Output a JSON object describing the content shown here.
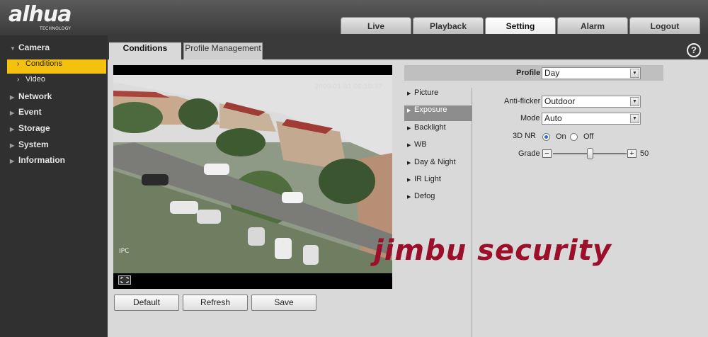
{
  "brand": {
    "name": "alhua",
    "tagline": "TECHNOLOGY"
  },
  "nav_tabs": [
    "Live",
    "Playback",
    "Setting",
    "Alarm",
    "Logout"
  ],
  "nav_active": "Setting",
  "sidebar": {
    "camera": "Camera",
    "sub_items": [
      "Conditions",
      "Video"
    ],
    "sub_active": "Conditions",
    "sections": [
      "Network",
      "Event",
      "Storage",
      "System",
      "Information"
    ]
  },
  "content_tabs": [
    "Conditions",
    "Profile Management"
  ],
  "content_tab_active": "Conditions",
  "help_label": "?",
  "video": {
    "timestamp": "2000-01-01 00:10:37",
    "channel": "IPC"
  },
  "buttons": {
    "default": "Default",
    "refresh": "Refresh",
    "save": "Save"
  },
  "profile": {
    "label": "Profile",
    "value": "Day"
  },
  "menu": [
    "Picture",
    "Exposure",
    "Backlight",
    "WB",
    "Day & Night",
    "IR Light",
    "Defog"
  ],
  "menu_active": "Exposure",
  "exposure": {
    "anti_flicker_label": "Anti-flicker",
    "anti_flicker_value": "Outdoor",
    "mode_label": "Mode",
    "mode_value": "Auto",
    "nr_label": "3D NR",
    "nr_on": "On",
    "nr_off": "Off",
    "nr_selected": "On",
    "grade_label": "Grade",
    "grade_value": 50,
    "grade_max": 100,
    "minus": "−",
    "plus": "+"
  },
  "watermark": "jimbu security",
  "colors": {
    "accent_yellow": "#f4c10e",
    "watermark_red": "#9c0f2a"
  }
}
